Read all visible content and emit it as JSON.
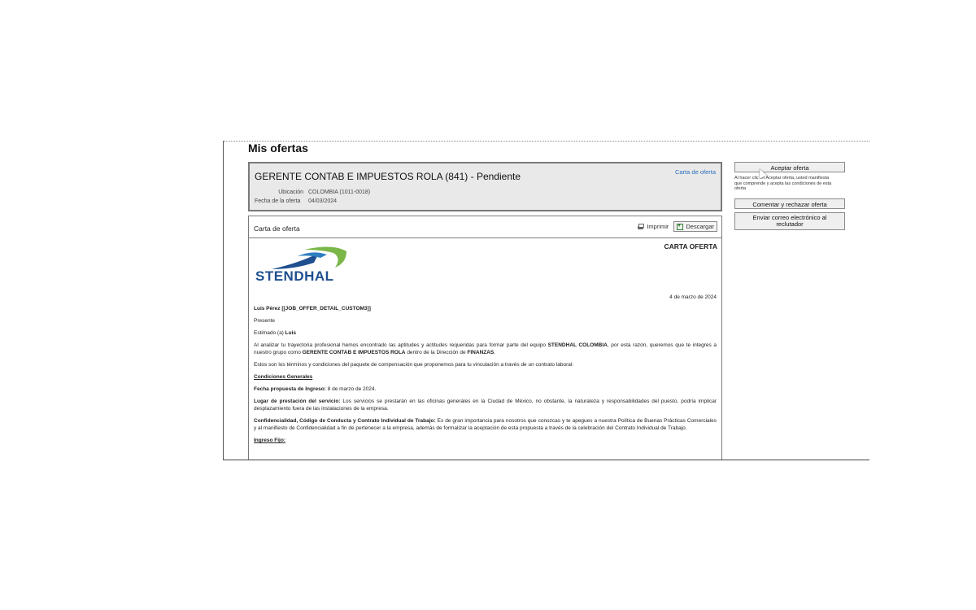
{
  "page": {
    "title": "Mis ofertas"
  },
  "offer": {
    "title": "GERENTE CONTAB E IMPUESTOS ROLA (841) - Pendiente",
    "link_label": "Carta de oferta",
    "location_label": "Ubicación",
    "location_value": "COLOMBIA (1011-0018)",
    "date_label": "Fecha de la oferta",
    "date_value": "04/03/2024"
  },
  "letter_panel": {
    "title": "Carta de oferta",
    "print_label": "Imprimir",
    "download_label": "Descargar",
    "print_icon": "printer-icon",
    "download_icon": "download-icon"
  },
  "letter": {
    "heading": "CARTA OFERTA",
    "logo_text": "STENDHAL",
    "date": "4 de marzo de 2024",
    "recipient": "Luis Pérez [[JOB_OFFER_DETAIL_CUSTOM3]]",
    "presente": "Presente",
    "greeting_prefix": "Estimado (a) ",
    "greeting_name": "Luis",
    "intro_1": "Al analizar tu trayectoria profesional hemos encontrado las aptitudes y actitudes requeridas para formar parte del equipo ",
    "intro_company": "STENDHAL COLOMBIA",
    "intro_2": ", por esta razón, queremos que te integres a nuestro grupo como ",
    "intro_position": "GERENTE CONTAB E IMPUESTOS ROLA",
    "intro_3": " dentro de la Dirección de ",
    "intro_dept": "FINANZAS",
    "intro_4": ".",
    "terms": "Estos son los términos y condiciones del paquete de compensación que proponemos para tu vinculación a través de un contrato laboral:",
    "conditions_title": "Condiciones Generales",
    "start_label": "Fecha propuesta de Ingreso:",
    "start_value": " 8 de marzo de 2024.",
    "place_label": "Lugar de prestación del servicio:",
    "place_text": " Los servicios se prestarán en las oficinas generales en la Ciudad de México, no obstante, la naturaleza y responsabilidades del puesto, podría implicar desplazamiento fuera de las instalaciones de la empresa.",
    "conf_label": "Confidencialidad, Código de Conducta y Contrato Individual de Trabajo:",
    "conf_text": " Es de gran importancia para nosotros que conozcas y te apegues a nuestra Política de Buenas Prácticas Comerciales y al manifiesto de Confidencialidad a fin de pertenecer a la empresa, además de formalizar la aceptación de esta propuesta a través de la celebración del Contrato Individual de Trabajo.",
    "income_title": "Ingreso Fijo:"
  },
  "actions": {
    "accept_label": "Aceptar oferta",
    "accept_note": "Al hacer clic en Aceptar oferta, usted manifiesta que comprende y acepta las condiciones de esta oferta",
    "reject_label": "Comentar y rechazar oferta",
    "email_label": "Enviar correo electrónico al reclutador"
  },
  "colors": {
    "link": "#2a6ebb",
    "logo_blue": "#1f4f8f",
    "logo_green": "#7ab648"
  }
}
